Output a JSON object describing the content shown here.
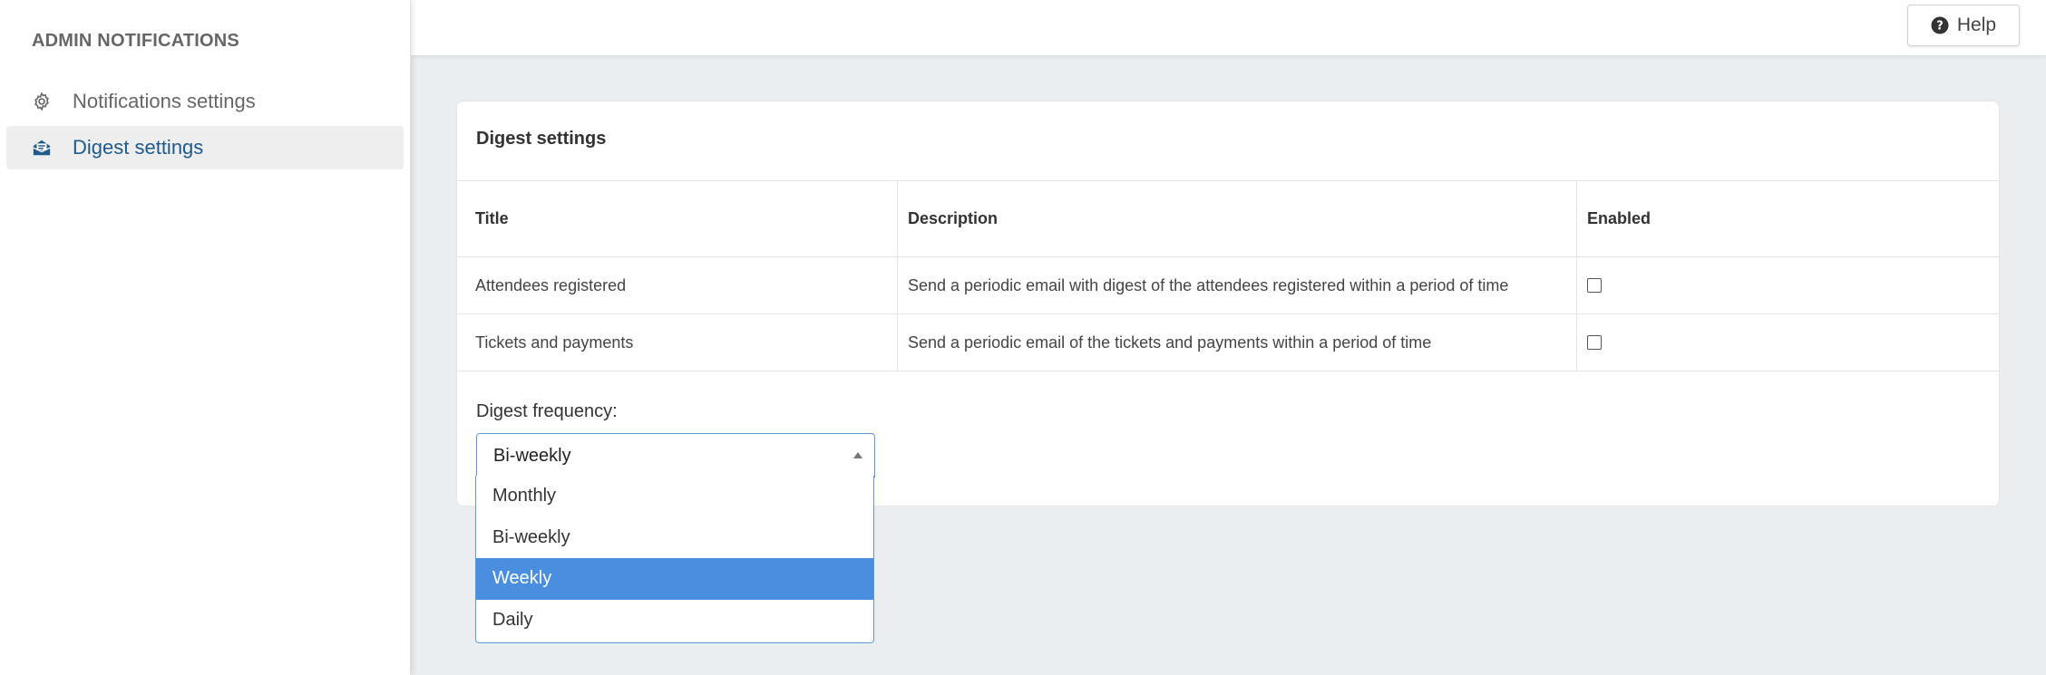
{
  "sidebar": {
    "heading": "ADMIN NOTIFICATIONS",
    "items": [
      {
        "label": "Notifications settings",
        "icon": "gear-icon",
        "active": false
      },
      {
        "label": "Digest settings",
        "icon": "envelope-open-icon",
        "active": true
      }
    ]
  },
  "header": {
    "help_label": "Help",
    "help_icon": "question-circle-icon"
  },
  "card": {
    "title": "Digest settings",
    "table": {
      "columns": [
        "Title",
        "Description",
        "Enabled"
      ],
      "rows": [
        {
          "title": "Attendees registered",
          "description": "Send a periodic email with digest of the attendees registered within a period of time",
          "enabled": false
        },
        {
          "title": "Tickets and payments",
          "description": "Send a periodic email of the tickets and payments within a period of time",
          "enabled": false
        }
      ]
    },
    "frequency": {
      "label": "Digest frequency:",
      "selected": "Bi-weekly",
      "options": [
        "Monthly",
        "Bi-weekly",
        "Weekly",
        "Daily"
      ],
      "highlighted": "Weekly"
    }
  },
  "colors": {
    "accent": "#1e5a8c",
    "highlight": "#4a8fdf",
    "focus_border": "#5b9bd5"
  }
}
